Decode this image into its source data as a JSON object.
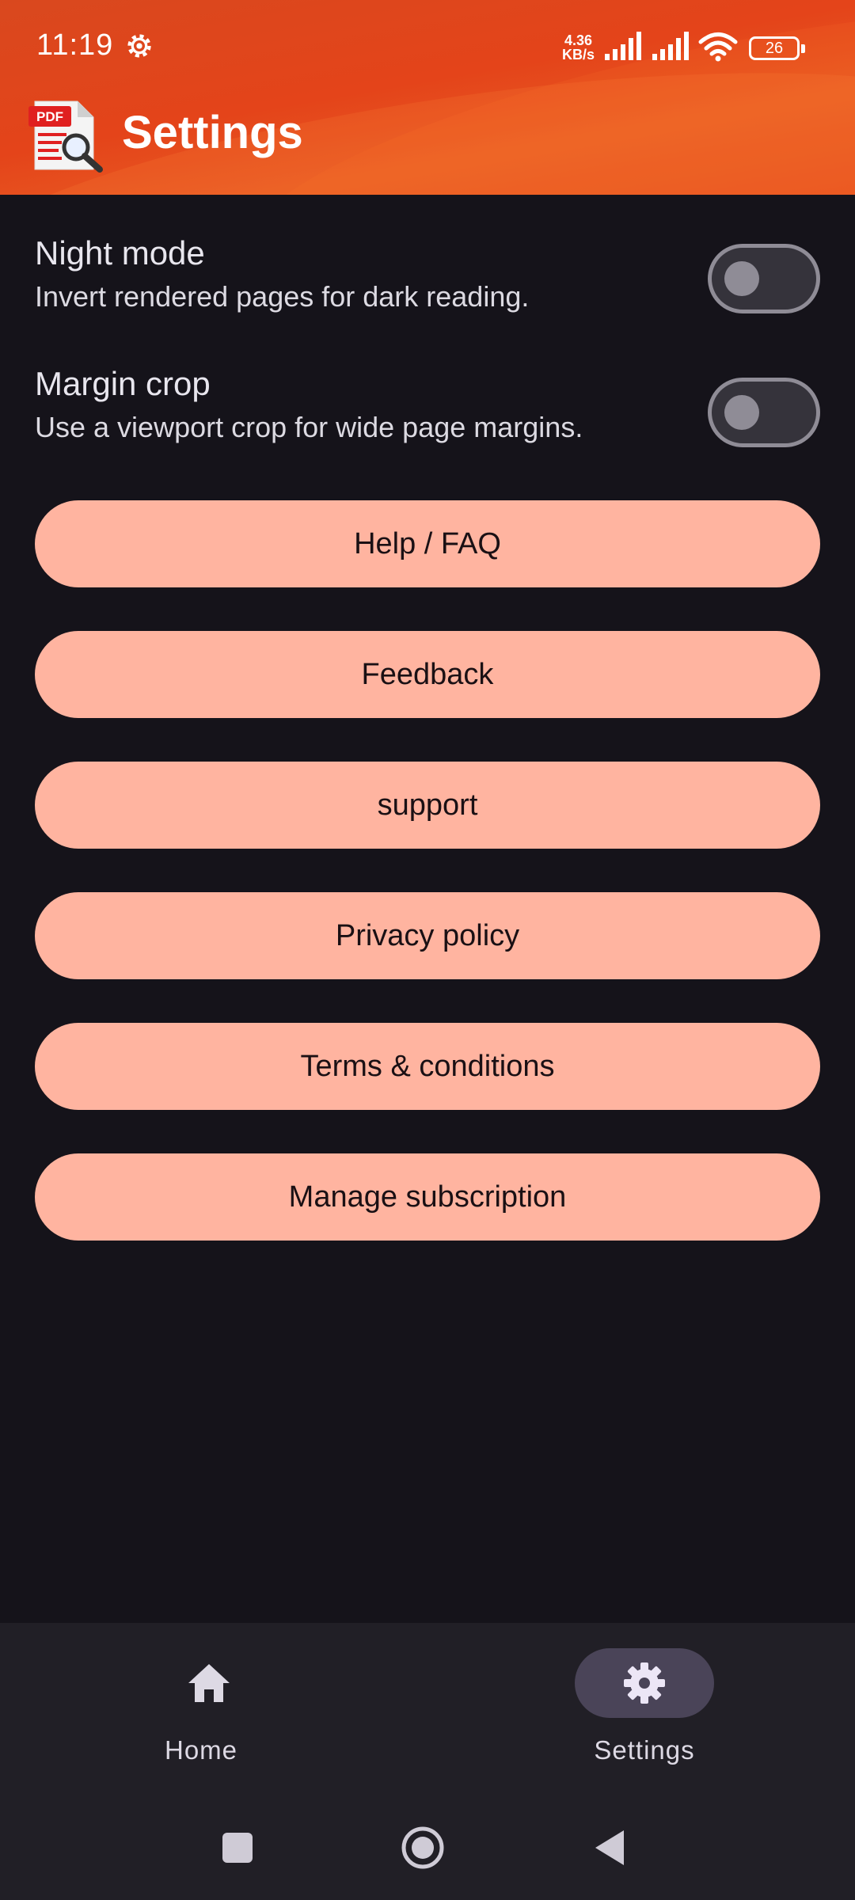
{
  "status_bar": {
    "time": "11:19",
    "net_speed_value": "4.36",
    "net_speed_unit": "KB/s",
    "battery_level": "26"
  },
  "app_bar": {
    "title": "Settings",
    "logo_text": "PDF"
  },
  "settings": {
    "night_mode": {
      "title": "Night mode",
      "subtitle": "Invert rendered pages for dark reading.",
      "enabled": false
    },
    "margin_crop": {
      "title": "Margin crop",
      "subtitle": "Use a viewport crop for wide page margins.",
      "enabled": false
    }
  },
  "buttons": {
    "help": "Help / FAQ",
    "feedback": "Feedback",
    "support": "support",
    "privacy": "Privacy policy",
    "terms": "Terms & conditions",
    "subscription": "Manage subscription"
  },
  "bottom_nav": {
    "items": [
      {
        "label": "Home",
        "icon": "home-icon",
        "active": false
      },
      {
        "label": "Settings",
        "icon": "gear-icon",
        "active": true
      }
    ]
  },
  "colors": {
    "header": "#e4441a",
    "background": "#15131a",
    "button": "#ffb4a0",
    "nav_background": "#211f26",
    "nav_active_pill": "#4a4458"
  }
}
